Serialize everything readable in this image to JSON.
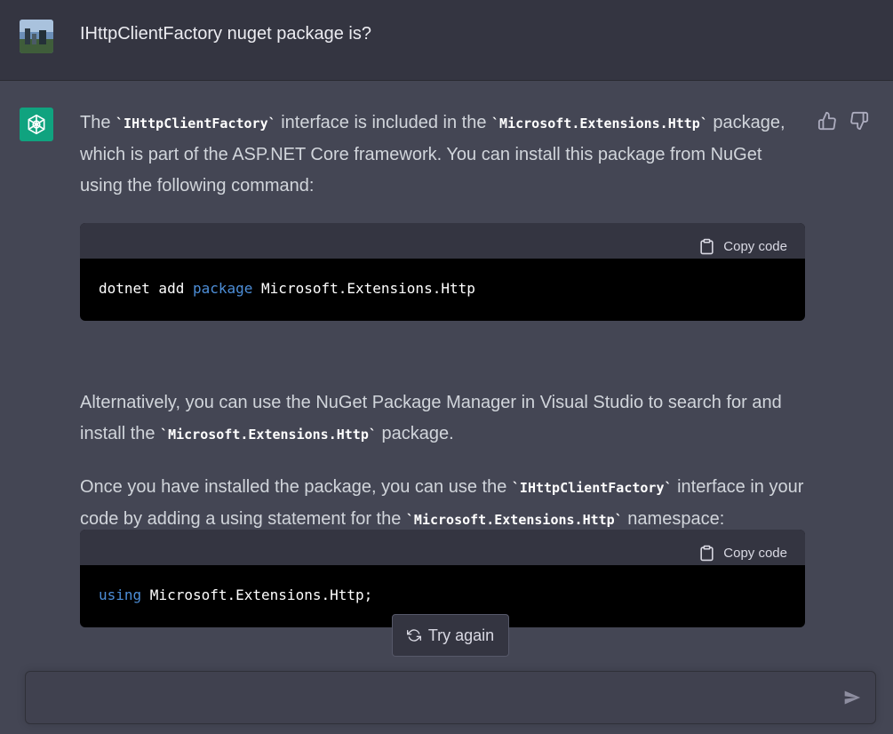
{
  "user_message": {
    "text": "IHttpClientFactory nuget package is?"
  },
  "assistant": {
    "p1": {
      "t1": "The ",
      "c1": "`IHttpClientFactory`",
      "t2": " interface is included in the ",
      "c2": "`Microsoft.Extensions.Http`",
      "t3": " package, which is part of the ASP.NET Core framework. You can install this package from NuGet using the following command:"
    },
    "code1": {
      "copy_label": "Copy code",
      "t1": "dotnet add ",
      "kw": "package",
      "t2": " Microsoft.Extensions.Http"
    },
    "p2": {
      "t1": "Alternatively, you can use the NuGet Package Manager in Visual Studio to search for and install the ",
      "c1": "`Microsoft.Extensions.Http`",
      "t2": " package."
    },
    "p3": {
      "t1": "Once you have installed the package, you can use the ",
      "c1": "`IHttpClientFactory`",
      "t2": " interface in your code by adding a using statement for the ",
      "c2": "`Microsoft.Extensions.Http`",
      "t3": " namespace:"
    },
    "code2": {
      "copy_label": "Copy code",
      "kw": "using",
      "t1": " Microsoft.Extensions.Http;"
    }
  },
  "controls": {
    "try_again_label": "Try again",
    "thumbs_up_icon": "thumbs-up-icon",
    "thumbs_down_icon": "thumbs-down-icon",
    "send_icon": "send-icon"
  },
  "colors": {
    "user_bg": "#343541",
    "assistant_bg": "#444654",
    "accent": "#10a37f",
    "keyword": "#4d8ed8"
  }
}
